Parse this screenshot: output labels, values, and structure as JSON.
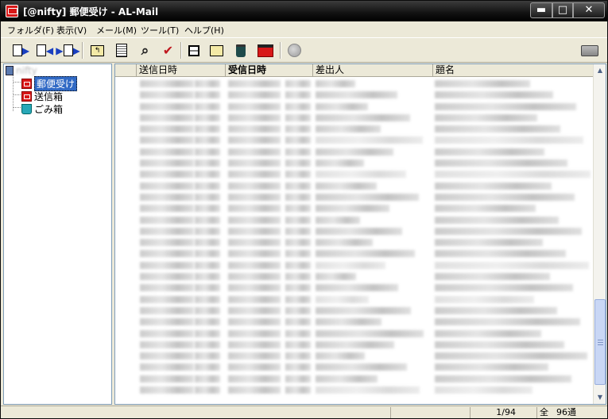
{
  "window": {
    "title": "[@nifty] 郵便受け - AL-Mail",
    "min_glyph": "▬",
    "max_glyph": "□",
    "close_glyph": "✕"
  },
  "menu": [
    "フォルダ(F)",
    "表示(V)",
    "メール(M)",
    "ツール(T)",
    "ヘルプ(H)"
  ],
  "toolbar": {
    "icons": [
      "mail-in-icon",
      "forward-mail-icon",
      "move-mail-icon",
      "folder-up-icon",
      "document-icon",
      "binoculars-icon",
      "checkmark-icon",
      "save-icon",
      "export-icon",
      "trash-icon",
      "mailbox-icon",
      "stop-icon",
      "print-icon"
    ],
    "check_glyph": "✔",
    "search_glyph": "⌕"
  },
  "tree": {
    "root_label": "nifty",
    "folders": [
      "郵便受け",
      "送信箱",
      "ごみ箱"
    ]
  },
  "list": {
    "columns": [
      "送信日時",
      "受信日時",
      "差出人",
      "題名"
    ]
  },
  "scrollbar": {
    "up_glyph": "▲",
    "down_glyph": "▼"
  },
  "status": {
    "position": "1/94",
    "total_label": "全",
    "total_count": "96通"
  }
}
